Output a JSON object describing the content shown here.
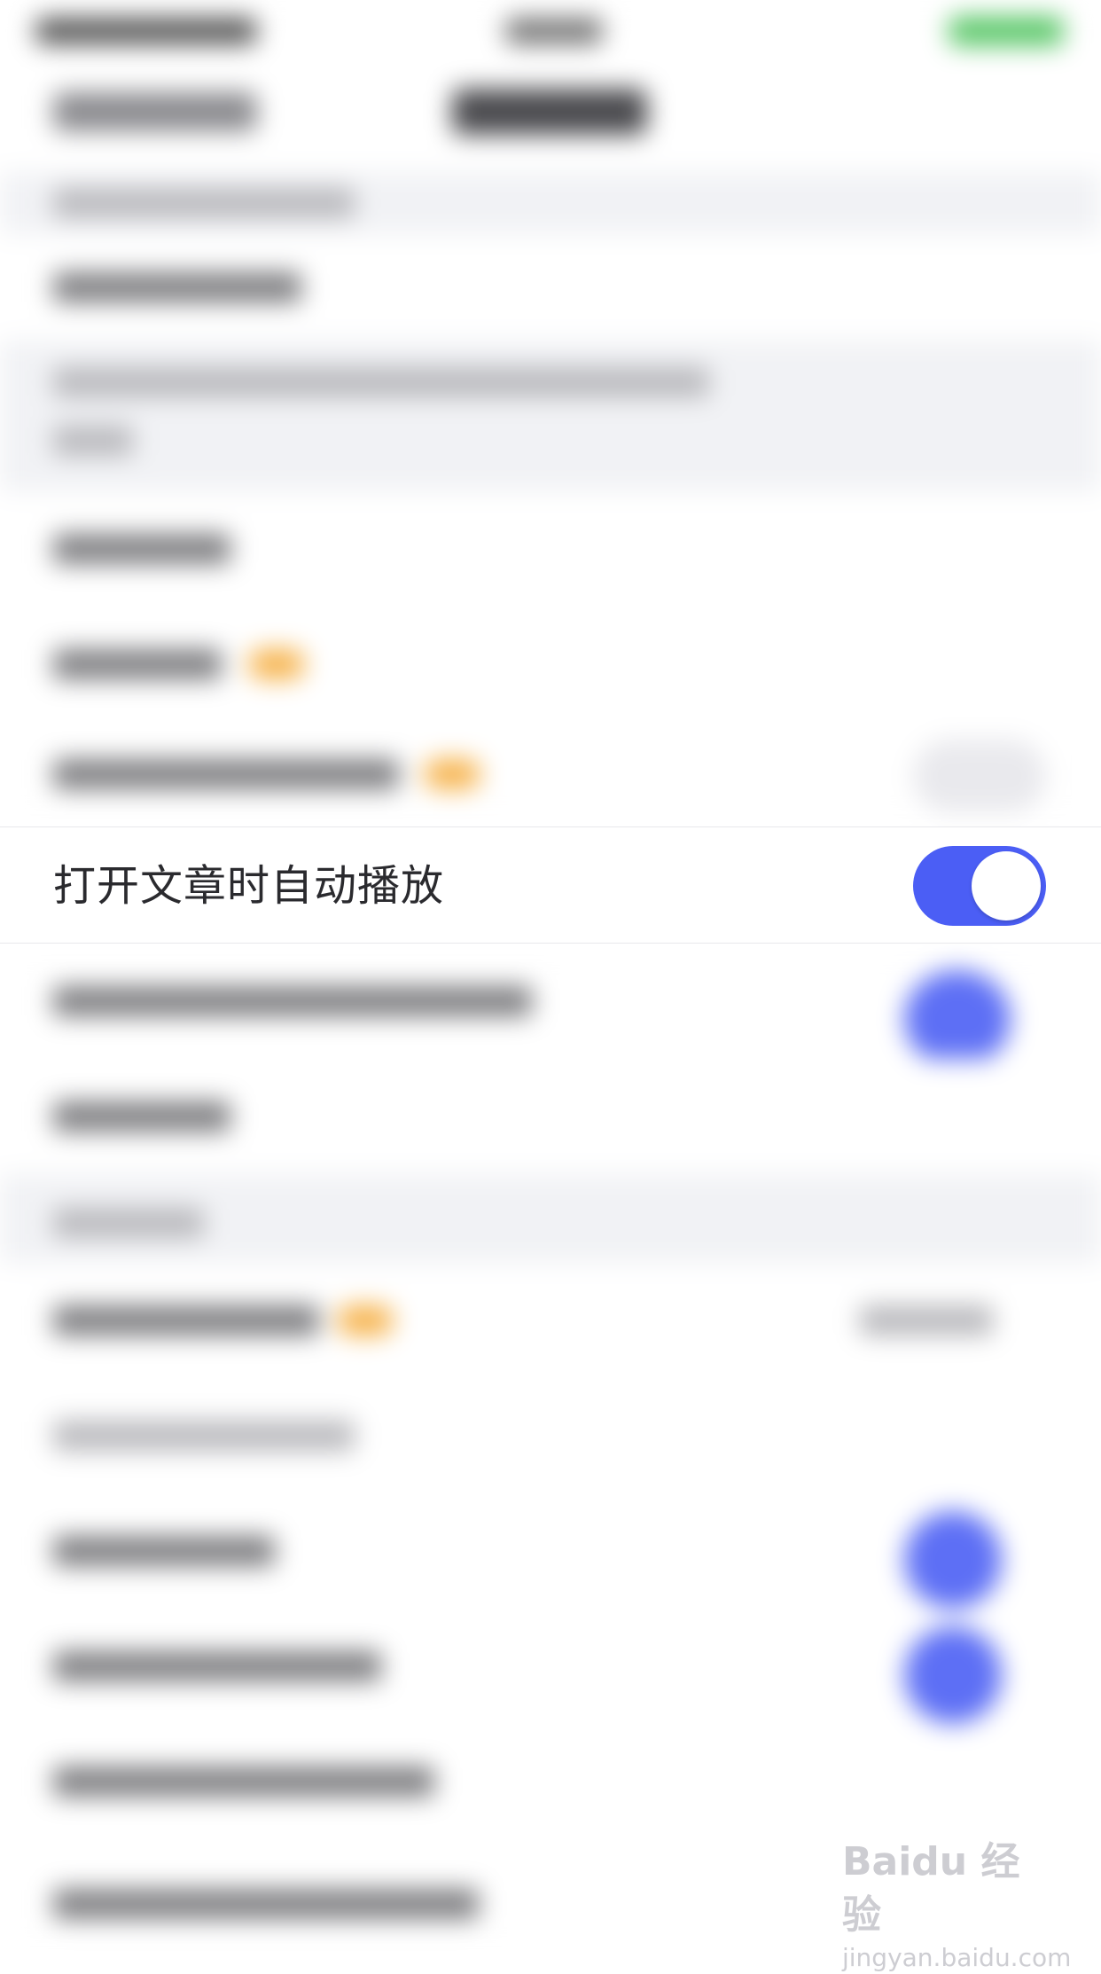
{
  "focus_row": {
    "label": "打开文章时自动播放",
    "toggle_on": true
  },
  "watermark": {
    "logo": "Baidu 经验",
    "url": "jingyan.baidu.com"
  },
  "colors": {
    "accent": "#4b5ef5",
    "background": "#ffffff",
    "section_gray": "#f1f2f5",
    "badge": "#f6b24a"
  }
}
